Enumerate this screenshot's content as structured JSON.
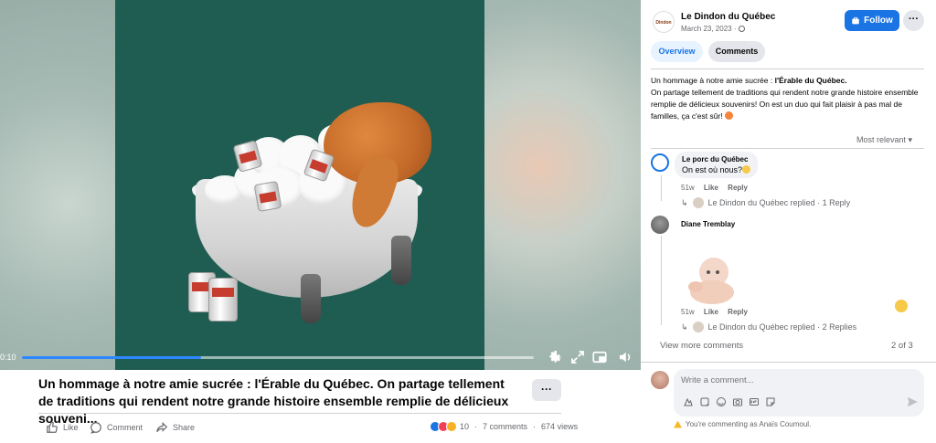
{
  "video": {
    "time": "0:10",
    "progress_fraction": 0.35
  },
  "post": {
    "title": "Un hommage à notre amie sucrée : l'Érable du Québec. On partage tellement de traditions qui rendent notre grande histoire ensemble remplie de délicieux souveni...",
    "more_label": "···",
    "actions": {
      "like": "Like",
      "comment": "Comment",
      "share": "Share"
    },
    "reaction_count": "10",
    "comments_count": "7 comments",
    "views": "674 views"
  },
  "panel": {
    "page_name": "Le Dindon du Québec",
    "logo_text": "Dindon",
    "date": "March 23, 2023 · ",
    "follow_label": "Follow",
    "more_label": "···",
    "tabs": [
      "Overview",
      "Comments"
    ],
    "description_bold": "l'Érable du Québec.",
    "description_prefix": "Un hommage à notre amie sucrée : ",
    "description_rest": "On partage tellement de traditions qui rendent notre grande histoire ensemble remplie de délicieux souvenirs! On est un duo qui fait plaisir à pas mal de familles, ça c'est sûr! ",
    "sort_label": "Most relevant ▾"
  },
  "comments": [
    {
      "author": "Le porc du Québec",
      "text": "On est où nous?",
      "age": "51w",
      "like": "Like",
      "reply": "Reply",
      "replied": "Le Dindon du Québec replied · 1 Reply"
    },
    {
      "author": "Diane Tremblay",
      "text": "",
      "age": "51w",
      "like": "Like",
      "reply": "Reply",
      "replied": "Le Dindon du Québec replied · 2 Replies"
    }
  ],
  "footer": {
    "view_more": "View more comments",
    "count": "2 of 3",
    "placeholder": "Write a comment...",
    "warning": "You're commenting as Anaïs Coumoul."
  },
  "colors": {
    "accent": "#1b74e4",
    "video_bg": "#1f5d52"
  }
}
